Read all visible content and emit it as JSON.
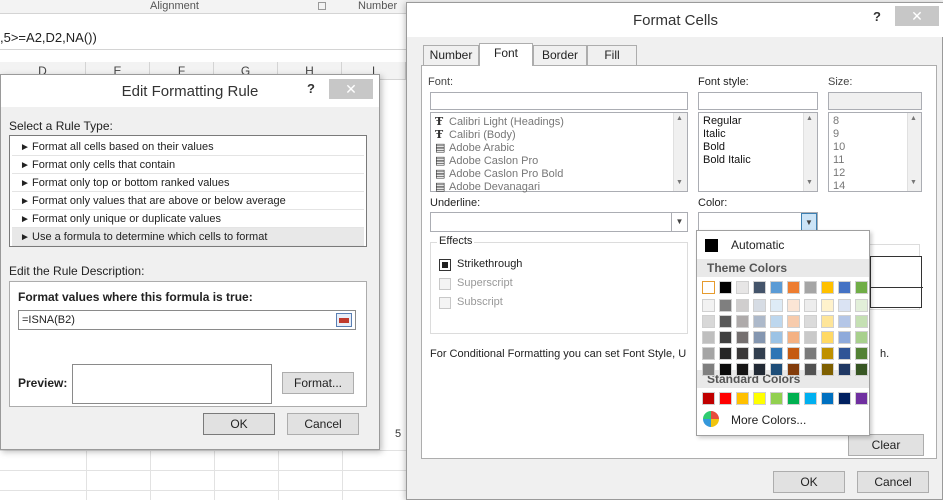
{
  "excel": {
    "ribbon_groups": [
      "Alignment",
      "Number"
    ],
    "formula_text": ",5>=A2,D2,NA())",
    "columns": [
      "D",
      "E",
      "F",
      "G",
      "H",
      "I"
    ],
    "cell_value": "5"
  },
  "edit_rule_dialog": {
    "title": "Edit Formatting Rule",
    "help": "?",
    "close": "✕",
    "select_type_label": "Select a Rule Type:",
    "rule_types": [
      "Format all cells based on their values",
      "Format only cells that contain",
      "Format only top or bottom ranked values",
      "Format only values that are above or below average",
      "Format only unique or duplicate values",
      "Use a formula to determine which cells to format"
    ],
    "selected_rule_index": 5,
    "edit_desc_label": "Edit the Rule Description:",
    "formula_label": "Format values where this formula is true:",
    "formula_value": "=ISNA(B2)",
    "preview_label": "Preview:",
    "format_button": "Format...",
    "ok_button": "OK",
    "cancel_button": "Cancel"
  },
  "format_cells_dialog": {
    "title": "Format Cells",
    "help": "?",
    "close": "✕",
    "tabs": [
      "Number",
      "Font",
      "Border",
      "Fill"
    ],
    "active_tab": "Font",
    "font_label": "Font:",
    "font_style_label": "Font style:",
    "size_label": "Size:",
    "fonts": [
      "Calibri Light (Headings)",
      "Calibri (Body)",
      "Adobe Arabic",
      "Adobe Caslon Pro",
      "Adobe Caslon Pro Bold",
      "Adobe Devanagari"
    ],
    "font_styles": [
      "Regular",
      "Italic",
      "Bold",
      "Bold Italic"
    ],
    "sizes": [
      "8",
      "9",
      "10",
      "11",
      "12",
      "14"
    ],
    "underline_label": "Underline:",
    "color_label": "Color:",
    "effects_label": "Effects",
    "effects": [
      {
        "label": "Strikethrough",
        "checked": true,
        "disabled": false
      },
      {
        "label": "Superscript",
        "checked": false,
        "disabled": true
      },
      {
        "label": "Subscript",
        "checked": false,
        "disabled": true
      }
    ],
    "note": "For Conditional Formatting you can set Font Style, U",
    "note_tail": "h.",
    "clear_button": "Clear",
    "ok_button": "OK",
    "cancel_button": "Cancel"
  },
  "color_popup": {
    "automatic_label": "Automatic",
    "theme_colors_label": "Theme Colors",
    "standard_colors_label": "Standard Colors",
    "more_colors_label": "More Colors...",
    "theme_top": [
      "#ffffff",
      "#000000",
      "#e7e6e6",
      "#44546a",
      "#5b9bd5",
      "#ed7d31",
      "#a5a5a5",
      "#ffc000",
      "#4472c4",
      "#70ad47"
    ],
    "theme_shades": [
      [
        "#f2f2f2",
        "#7f7f7f",
        "#d0cece",
        "#d6dce4",
        "#deebf6",
        "#fbe5d5",
        "#ededed",
        "#fff2cc",
        "#dae3f3",
        "#e2efd9"
      ],
      [
        "#d8d8d8",
        "#595959",
        "#aeaaaa",
        "#adb9ca",
        "#bdd7ee",
        "#f7cbac",
        "#dbdbdb",
        "#fee599",
        "#b4c6e7",
        "#c5e0b3"
      ],
      [
        "#bfbfbf",
        "#3f3f3f",
        "#757070",
        "#8496b0",
        "#9cc3e5",
        "#f4b183",
        "#c9c9c9",
        "#ffd965",
        "#8eaadb",
        "#a8d08d"
      ],
      [
        "#a5a5a5",
        "#262626",
        "#3a3838",
        "#323f4f",
        "#2e75b5",
        "#c55a11",
        "#7b7b7b",
        "#bf9000",
        "#2f5496",
        "#538135"
      ],
      [
        "#7f7f7f",
        "#0c0c0c",
        "#171616",
        "#222a35",
        "#1e4e79",
        "#833c0b",
        "#525252",
        "#7f6000",
        "#1f3864",
        "#375623"
      ]
    ],
    "standard": [
      "#c00000",
      "#ff0000",
      "#ffc000",
      "#ffff00",
      "#92d050",
      "#00b050",
      "#00b0f0",
      "#0070c0",
      "#002060",
      "#7030a0"
    ],
    "selected_swatch": "#ffffff"
  }
}
